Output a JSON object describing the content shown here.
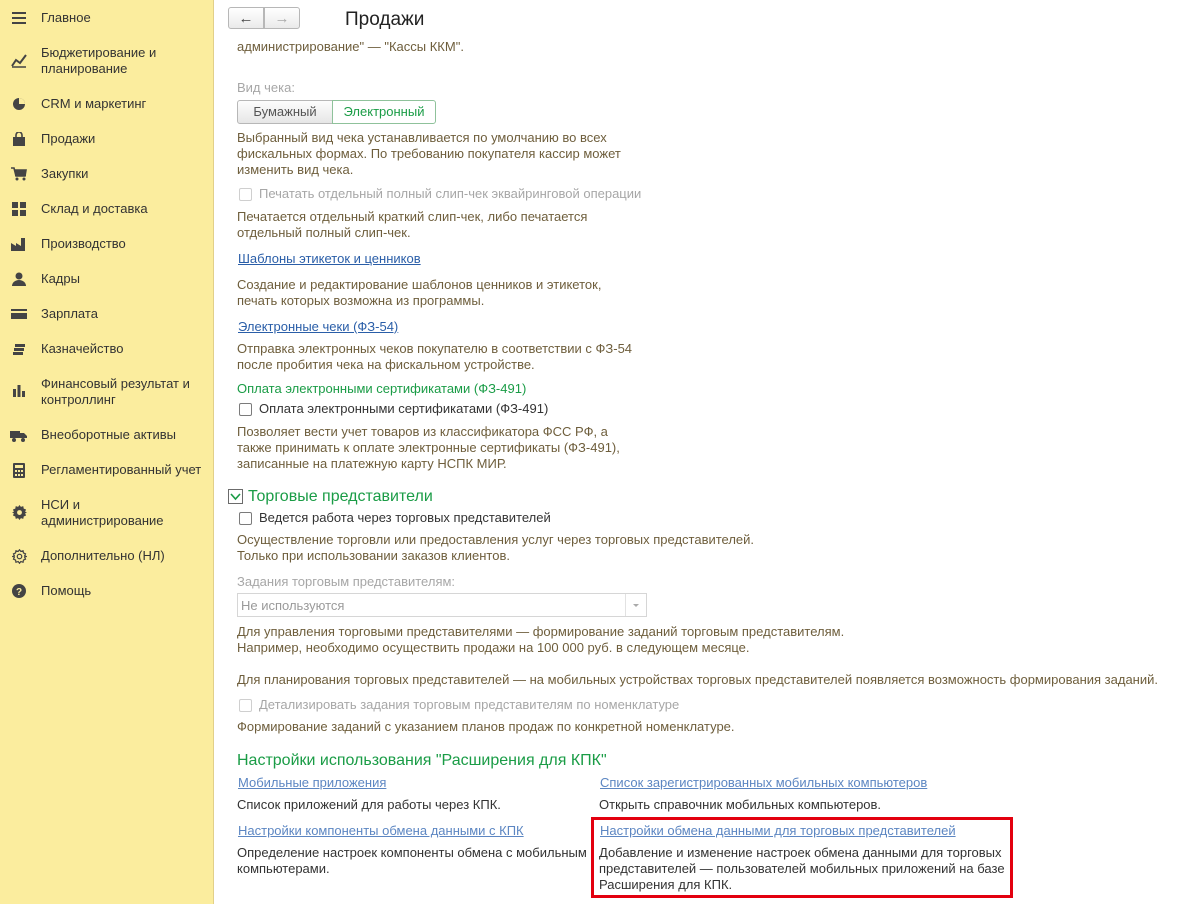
{
  "sidebar": {
    "items": [
      {
        "label": "Главное",
        "icon": "menu-icon"
      },
      {
        "label": "Бюджетирование и планирование",
        "icon": "chart-icon"
      },
      {
        "label": "CRM и маркетинг",
        "icon": "pie-icon"
      },
      {
        "label": "Продажи",
        "icon": "bag-icon"
      },
      {
        "label": "Закупки",
        "icon": "cart-icon"
      },
      {
        "label": "Склад и доставка",
        "icon": "grid-icon"
      },
      {
        "label": "Производство",
        "icon": "factory-icon"
      },
      {
        "label": "Кадры",
        "icon": "person-icon"
      },
      {
        "label": "Зарплата",
        "icon": "card-icon"
      },
      {
        "label": "Казначейство",
        "icon": "coins-icon"
      },
      {
        "label": "Финансовый результат и контроллинг",
        "icon": "bar-icon"
      },
      {
        "label": "Внеоборотные активы",
        "icon": "truck-icon"
      },
      {
        "label": "Регламентированный учет",
        "icon": "calculator-icon"
      },
      {
        "label": "НСИ и администрирование",
        "icon": "gear-icon"
      },
      {
        "label": "Дополнительно (НЛ)",
        "icon": "gear-outline-icon"
      },
      {
        "label": "Помощь",
        "icon": "help-icon"
      }
    ]
  },
  "header": {
    "title": "Продажи",
    "back": "←",
    "forward": "→"
  },
  "content": {
    "top_text": "администрирование\" — \"Кассы ККМ\".",
    "receipt_type_label": "Вид чека:",
    "paper": "Бумажный",
    "electronic": "Электронный",
    "receipt_hint_1": "Выбранный вид чека устанавливается по умолчанию во всех",
    "receipt_hint_2": "фискальных формах. По требованию покупателя кассир может",
    "receipt_hint_3": "изменить вид чека.",
    "slip_check": "Печатать отдельный полный слип-чек эквайринговой операции",
    "slip_hint_1": "Печатается отдельный краткий слип-чек, либо печатается",
    "slip_hint_2": "отдельный полный слип-чек.",
    "templates_link": "Шаблоны этикеток и ценников",
    "templates_hint_1": "Создание и редактирование шаблонов ценников и этикеток,",
    "templates_hint_2": "печать которых возможна из программы.",
    "echecks_link": "Электронные чеки (ФЗ-54)",
    "echecks_hint_1": "Отправка электронных чеков покупателю в соответствии с ФЗ-54",
    "echecks_hint_2": "после пробития чека на фискальном устройстве.",
    "certs_heading": "Оплата электронными сертификатами (ФЗ-491)",
    "certs_check": "Оплата электронными сертификатами (ФЗ-491)",
    "certs_hint_1": "Позволяет вести учет товаров из классификатора ФСС РФ, а",
    "certs_hint_2": "также принимать к оплате электронные сертификаты (ФЗ-491),",
    "certs_hint_3": "записанные на платежную карту НСПК МИР.",
    "reps_section": "Торговые представители",
    "reps_check": "Ведется работа через торговых представителей",
    "reps_hint_1": "Осуществление торговли или предоставления услуг через торговых представителей.",
    "reps_hint_2": "Только при использовании заказов клиентов.",
    "tasks_label": "Задания торговым представителям:",
    "tasks_value": "Не используются",
    "tasks_hint_1": "Для управления торговыми представителями — формирование заданий торговым представителям.",
    "tasks_hint_2": "Например, необходимо осуществить продажи на 100 000 руб. в следующем месяце.",
    "tasks_hint_3": "Для планирования торговых представителей — на мобильных устройствах торговых представителей появляется возможность формирования заданий.",
    "detail_check": "Детализировать задания торговым представителям по номенклатуре",
    "detail_hint": "Формирование заданий с указанием планов продаж по конкретной номенклатуре.",
    "kpk_section": "Настройки использования \"Расширения для КПК\"",
    "mobile_apps_link": "Мобильные приложения",
    "mobile_apps_hint": "Список приложений для работы через КПК.",
    "registered_link": "Список зарегистрированных мобильных компьютеров",
    "registered_hint": "Открыть справочник мобильных компьютеров.",
    "component_link": "Настройки компоненты обмена данными с КПК",
    "component_hint_1": "Определение настроек компоненты обмена с мобильными",
    "component_hint_2": "компьютерами.",
    "exchange_link": "Настройки обмена данными для торговых представителей",
    "exchange_hint_1": "Добавление и изменение настроек обмена данными для торговых",
    "exchange_hint_2": "представителей — пользователей мобильных приложений на базе",
    "exchange_hint_3": "Расширения для КПК."
  }
}
